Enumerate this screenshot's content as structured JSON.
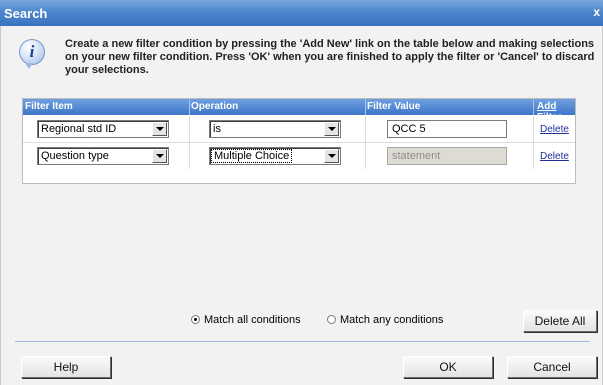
{
  "window": {
    "title": "Search",
    "close_glyph": "x"
  },
  "info": {
    "icon": "info-icon",
    "text": "Create a new filter condition by pressing the 'Add New' link on the table below and making selections on your new filter condition. Press 'OK' when you are finished to apply the filter or 'Cancel' to discard your selections."
  },
  "table": {
    "columns": {
      "item": "Filter Item",
      "operation": "Operation",
      "value": "Filter Value",
      "add": "Add Filter"
    },
    "rows": [
      {
        "item": "Regional std ID",
        "operation": "is",
        "value": "QCC 5",
        "value_disabled": false,
        "delete": "Delete"
      },
      {
        "item": "Question type",
        "operation": "Multiple Choice",
        "value": "statement",
        "value_disabled": true,
        "delete": "Delete"
      }
    ]
  },
  "match": {
    "all_label": "Match all conditions",
    "any_label": "Match any conditions",
    "selected": "all"
  },
  "buttons": {
    "delete_all": "Delete All",
    "help": "Help",
    "ok": "OK",
    "cancel": "Cancel"
  },
  "colors": {
    "title_bar": "#4d86cd",
    "header": "#3d76c8",
    "link": "#1f2f9c"
  }
}
